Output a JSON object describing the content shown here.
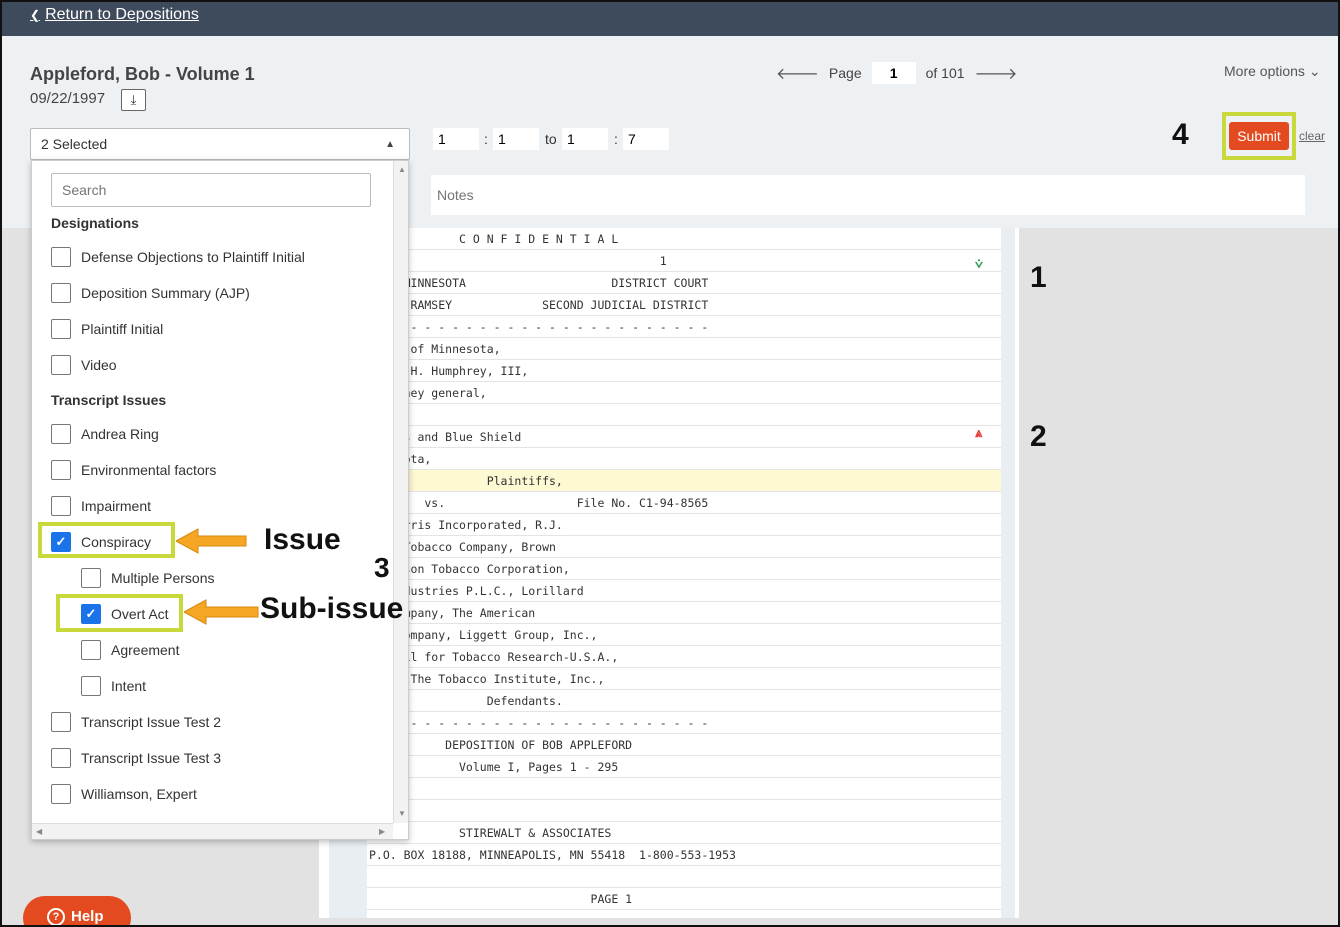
{
  "topbar": {
    "back_label": "Return to Depositions"
  },
  "header": {
    "title": "Appleford, Bob - Volume 1",
    "date": "09/22/1997",
    "page_label": "Page",
    "page_value": "1",
    "page_total": "of 101",
    "more_options": "More options"
  },
  "filter": {
    "selected_label": "2 Selected",
    "range": {
      "from_page": "1",
      "from_line": "1",
      "to_label": "to",
      "to_page": "1",
      "to_line": "7"
    },
    "notes_placeholder": "Notes",
    "submit_label": "Submit",
    "clear_label": "clear"
  },
  "dropdown": {
    "search_placeholder": "Search",
    "designations_heading": "Designations",
    "designations": [
      "Defense Objections to Plaintiff Initial",
      "Deposition Summary (AJP)",
      "Plaintiff Initial",
      "Video"
    ],
    "issues_heading": "Transcript Issues",
    "issues_top": [
      "Andrea Ring",
      "Environmental factors",
      "Impairment"
    ],
    "conspiracy": "Conspiracy",
    "sub_issues": [
      "Multiple Persons",
      "Overt Act",
      "Agreement",
      "Intent"
    ],
    "issues_bottom": [
      "Transcript Issue Test 2",
      "Transcript Issue Test 3",
      "Williamson, Expert"
    ]
  },
  "transcript": {
    "lines": [
      "             C O N F I D E N T I A L",
      "                                          1",
      "E OF MINNESOTA                     DISTRICT COURT",
      "TY OF RAMSEY             SECOND JUDICIAL DISTRICT",
      "- - - - - - - - - - - - - - - - - - - - - - - - -",
      "State of Minnesota,",
      "ubert H. Humphrey, III,",
      "attorney general,",
      "",
      " Cross and Blue Shield",
      "innesota,",
      "                 Plaintiffs,",
      "        vs.                   File No. C1-94-8565",
      "ip Morris Incorporated, R.J.",
      "olds Tobacco Company, Brown",
      "lliamson Tobacco Corporation,",
      "T. Industries P.L.C., Lorillard",
      "co Company, The American",
      "cco Company, Liggett Group, Inc.,",
      "Council for Tobacco Research-U.S.A.,",
      ", and The Tobacco Institute, Inc.,",
      "                 Defendants.",
      "- - - - - - - - - - - - - - - - - - - - - - - - -",
      "           DEPOSITION OF BOB APPLEFORD",
      "             Volume I, Pages 1 - 295",
      "",
      "",
      "             STIREWALT & ASSOCIATES",
      "P.O. BOX 18188, MINNEAPOLIS, MN 55418  1-800-553-1953",
      "",
      "                                PAGE 1"
    ]
  },
  "annotations": {
    "num1": "1",
    "num2": "2",
    "num3": "3",
    "num4": "4",
    "issue_label": "Issue",
    "subissue_label": "Sub-issue"
  },
  "help": {
    "label": "Help"
  },
  "colors": {
    "accent": "#e34a1f",
    "highlight": "#c9d93b",
    "arrow": "#f5a623",
    "topbar": "#3e4b5c"
  }
}
